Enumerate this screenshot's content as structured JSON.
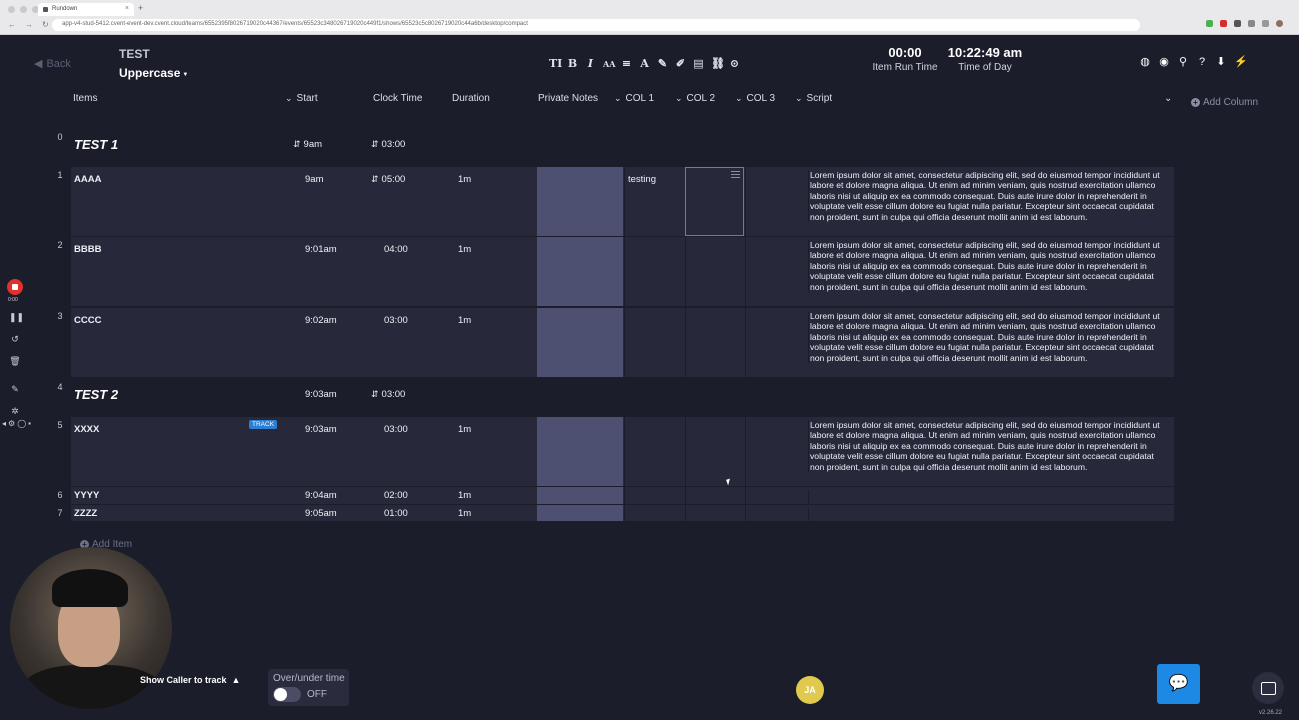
{
  "browser": {
    "tab_title": "Rundown",
    "url": "app-v4-stud-5412.cvent-event-dev.cvent.cloud/teams/6552395f8026719020c44367/events/65523c348026719020c449f1/shows/65523c5c8026719020c44a6b/desktop/compact"
  },
  "header": {
    "back_label": "Back",
    "show_title": "TEST",
    "case_selector": "Uppercase",
    "format_tools": [
      "TI",
      "B",
      "I",
      "AA",
      "≡",
      "A",
      "✎",
      "✐",
      "▤",
      "⛓",
      "⊙"
    ],
    "item_run_time": {
      "value": "00:00",
      "label": "Item Run Time"
    },
    "time_of_day": {
      "value": "10:22:49 am",
      "label": "Time of Day"
    },
    "icons": [
      "globe-icon",
      "eye-icon",
      "search-icon",
      "help-icon",
      "download-icon",
      "bolt-icon"
    ]
  },
  "columns": {
    "items": "Items",
    "start": "Start",
    "clock_time": "Clock Time",
    "duration": "Duration",
    "private_notes": "Private Notes",
    "col1": "COL 1",
    "col2": "COL 2",
    "col3": "COL 3",
    "script": "Script",
    "add_column": "Add Column"
  },
  "segments": [
    {
      "num": "0",
      "title": "TEST 1",
      "start": "9am",
      "duration": "03:00"
    },
    {
      "num": "4",
      "title": "TEST 2",
      "start": "9:03am",
      "duration": "03:00"
    }
  ],
  "rows": [
    {
      "num": "1",
      "name": "AAAA",
      "start": "9am",
      "clock": "05:00",
      "duration": "1m",
      "col1": "testing",
      "script": "Lorem ipsum dolor sit amet, consectetur adipiscing elit, sed do eiusmod tempor incididunt ut labore et dolore magna aliqua. Ut enim ad minim veniam, quis nostrud exercitation ullamco laboris nisi ut aliquip ex ea commodo consequat. Duis aute irure dolor in reprehenderit in voluptate velit esse cillum dolore eu fugiat nulla pariatur. Excepteur sint occaecat cupidatat non proident, sunt in culpa qui officia deserunt mollit anim id est laborum."
    },
    {
      "num": "2",
      "name": "BBBB",
      "start": "9:01am",
      "clock": "04:00",
      "duration": "1m",
      "col1": "",
      "script": "Lorem ipsum dolor sit amet, consectetur adipiscing elit, sed do eiusmod tempor incididunt ut labore et dolore magna aliqua. Ut enim ad minim veniam, quis nostrud exercitation ullamco laboris nisi ut aliquip ex ea commodo consequat. Duis aute irure dolor in reprehenderit in voluptate velit esse cillum dolore eu fugiat nulla pariatur. Excepteur sint occaecat cupidatat non proident, sunt in culpa qui officia deserunt mollit anim id est laborum."
    },
    {
      "num": "3",
      "name": "CCCC",
      "start": "9:02am",
      "clock": "03:00",
      "duration": "1m",
      "col1": "",
      "script": "Lorem ipsum dolor sit amet, consectetur adipiscing elit, sed do eiusmod tempor incididunt ut labore et dolore magna aliqua. Ut enim ad minim veniam, quis nostrud exercitation ullamco laboris nisi ut aliquip ex ea commodo consequat. Duis aute irure dolor in reprehenderit in voluptate velit esse cillum dolore eu fugiat nulla pariatur. Excepteur sint occaecat cupidatat non proident, sunt in culpa qui officia deserunt mollit anim id est laborum."
    },
    {
      "num": "5",
      "name": "XXXX",
      "badge": "TRACK",
      "start": "9:03am",
      "clock": "03:00",
      "duration": "1m",
      "col1": "",
      "script": "Lorem ipsum dolor sit amet, consectetur adipiscing elit, sed do eiusmod tempor incididunt ut labore et dolore magna aliqua. Ut enim ad minim veniam, quis nostrud exercitation ullamco laboris nisi ut aliquip ex ea commodo consequat. Duis aute irure dolor in reprehenderit in voluptate velit esse cillum dolore eu fugiat nulla pariatur. Excepteur sint occaecat cupidatat non proident, sunt in culpa qui officia deserunt mollit anim id est laborum."
    },
    {
      "num": "6",
      "name": "YYYY",
      "start": "9:04am",
      "clock": "02:00",
      "duration": "1m",
      "col1": "",
      "script": ""
    },
    {
      "num": "7",
      "name": "ZZZZ",
      "start": "9:05am",
      "clock": "01:00",
      "duration": "1m",
      "col1": "",
      "script": ""
    }
  ],
  "footer": {
    "add_item": "Add Item",
    "show_caller": "Show Caller to track",
    "over_under_label": "Over/under time",
    "over_under_state": "OFF",
    "avatar_initials": "JA",
    "version": "v2.26.22"
  },
  "colors": {
    "background": "#1b1d2b",
    "row": "#27293b",
    "private_notes": "#4d5070",
    "accent": "#1e88e5",
    "record": "#e0312d"
  }
}
